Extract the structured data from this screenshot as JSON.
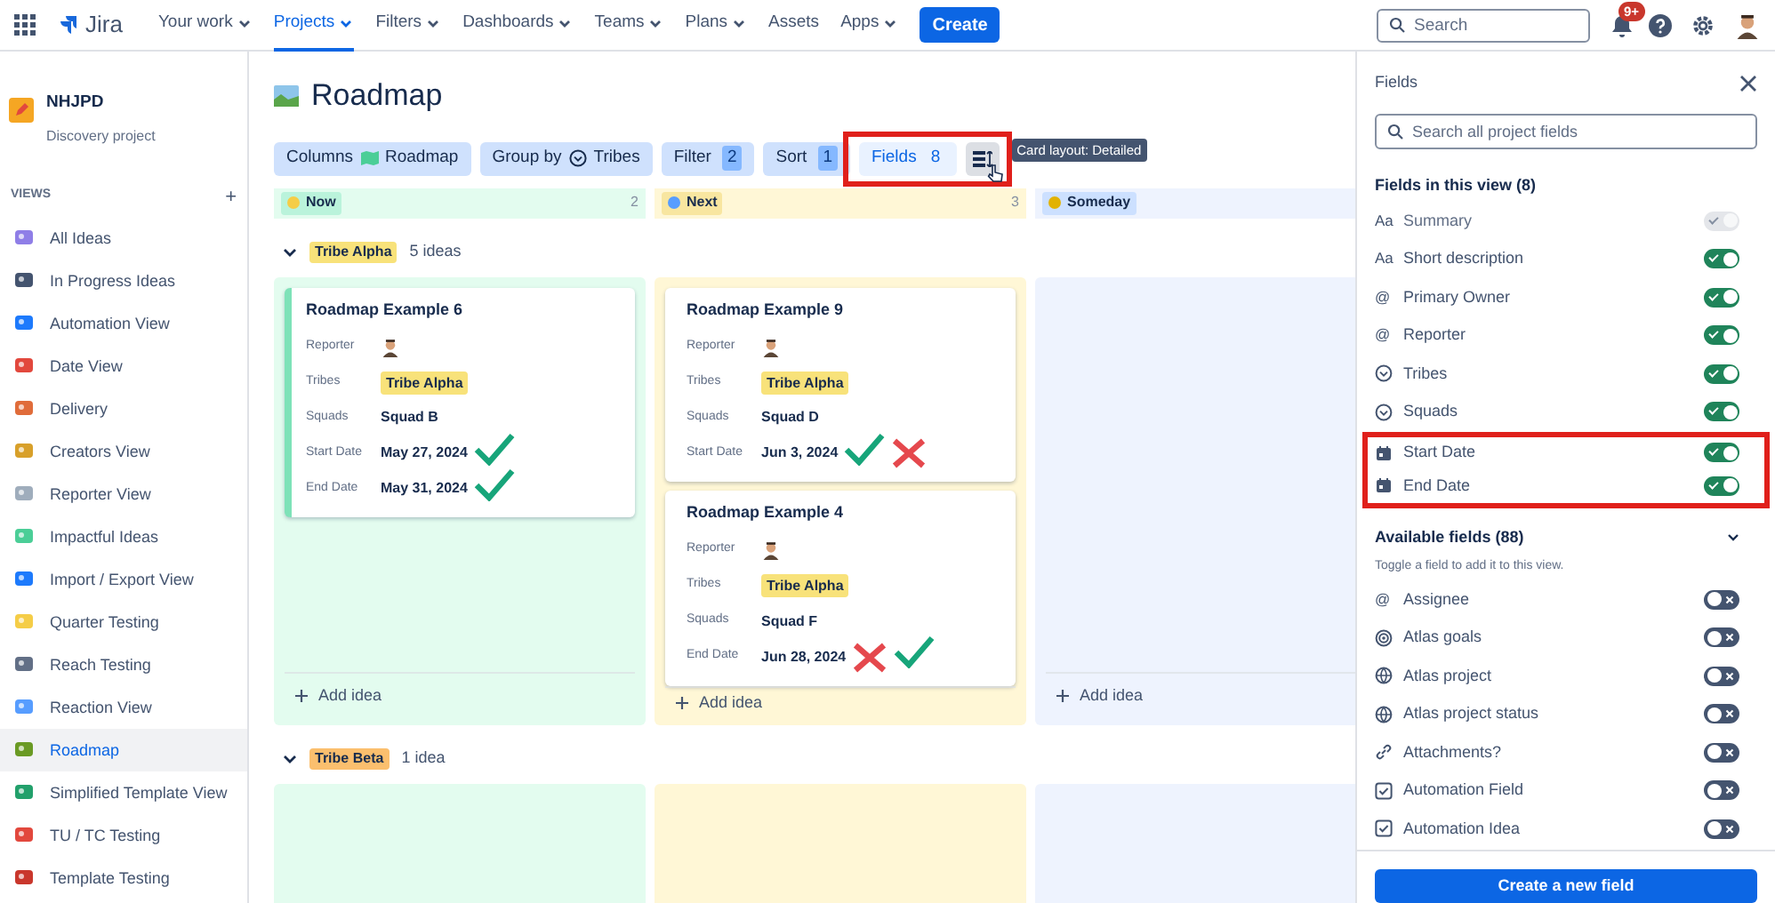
{
  "top_nav": {
    "product": "Jira",
    "items": [
      {
        "label": "Your work",
        "selected": false,
        "has_menu": true
      },
      {
        "label": "Projects",
        "selected": true,
        "has_menu": true
      },
      {
        "label": "Filters",
        "selected": false,
        "has_menu": true
      },
      {
        "label": "Dashboards",
        "selected": false,
        "has_menu": true
      },
      {
        "label": "Teams",
        "selected": false,
        "has_menu": true
      },
      {
        "label": "Plans",
        "selected": false,
        "has_menu": true
      },
      {
        "label": "Assets",
        "selected": false,
        "has_menu": false
      },
      {
        "label": "Apps",
        "selected": false,
        "has_menu": true
      }
    ],
    "create": "Create",
    "search": {
      "placeholder": "Search"
    },
    "notifications": "9+"
  },
  "sidebar": {
    "project": {
      "name": "NHJPD",
      "type": "Discovery project"
    },
    "section": "VIEWS",
    "add": "+",
    "items": [
      {
        "label": "All Ideas",
        "selected": false
      },
      {
        "label": "In Progress Ideas",
        "selected": false
      },
      {
        "label": "Automation View",
        "selected": false
      },
      {
        "label": "Date View",
        "selected": false
      },
      {
        "label": "Delivery",
        "selected": false
      },
      {
        "label": "Creators View",
        "selected": false
      },
      {
        "label": "Reporter View",
        "selected": false
      },
      {
        "label": "Impactful Ideas",
        "selected": false
      },
      {
        "label": "Import / Export View",
        "selected": false
      },
      {
        "label": "Quarter Testing",
        "selected": false
      },
      {
        "label": "Reach Testing",
        "selected": false
      },
      {
        "label": "Reaction View",
        "selected": false
      },
      {
        "label": "Roadmap",
        "selected": true
      },
      {
        "label": "Simplified Template View",
        "selected": false
      },
      {
        "label": "TU / TC Testing",
        "selected": false
      },
      {
        "label": "Template Testing",
        "selected": false
      }
    ]
  },
  "view": {
    "title": "Roadmap",
    "toolbar": [
      {
        "kind": "columns",
        "label": "Columns",
        "value": "Roadmap",
        "highlighted": false
      },
      {
        "kind": "group",
        "label": "Group by",
        "value": "Tribes",
        "highlighted": false
      },
      {
        "kind": "count",
        "label": "Filter",
        "value": "2",
        "highlighted": false
      },
      {
        "kind": "count",
        "label": "Sort",
        "value": "1",
        "highlighted": false
      },
      {
        "kind": "fields",
        "label": "Fields",
        "value": "8",
        "highlighted": true
      },
      {
        "kind": "layout",
        "highlighted": true,
        "tooltip": "Card layout: Detailed"
      }
    ],
    "columns": [
      {
        "label": "Now",
        "count": "2",
        "color": "#e3fcef"
      },
      {
        "label": "Next",
        "count": "3",
        "color": "#fff7d6"
      },
      {
        "label": "Someday",
        "color": "#eef3fe"
      }
    ],
    "lanes": [
      {
        "tag": "Tribe Alpha",
        "color": "#f8e27a",
        "count": "5 ideas",
        "expanded": true,
        "cells": [
          {
            "cards": [
              {
                "title": "Roadmap Example 6",
                "selected": true,
                "fields": [
                  {
                    "label": "Reporter",
                    "kind": "avatar"
                  },
                  {
                    "label": "Tribes",
                    "kind": "tag",
                    "value": "Tribe Alpha"
                  },
                  {
                    "label": "Squads",
                    "kind": "text",
                    "value": "Squad B"
                  },
                  {
                    "label": "Start Date",
                    "kind": "text",
                    "value": "May 27, 2024",
                    "marks": [
                      {
                        "kind": "check"
                      }
                    ]
                  },
                  {
                    "label": "End Date",
                    "kind": "text",
                    "value": "May 31, 2024",
                    "marks": [
                      {
                        "kind": "check"
                      }
                    ]
                  }
                ]
              }
            ],
            "add": "Add idea"
          },
          {
            "cards": [
              {
                "title": "Roadmap Example 9",
                "selected": false,
                "fields": [
                  {
                    "label": "Reporter",
                    "kind": "avatar"
                  },
                  {
                    "label": "Tribes",
                    "kind": "tag",
                    "value": "Tribe Alpha"
                  },
                  {
                    "label": "Squads",
                    "kind": "text",
                    "value": "Squad D"
                  },
                  {
                    "label": "Start Date",
                    "kind": "text",
                    "value": "Jun 3, 2024",
                    "marks": [
                      {
                        "kind": "check"
                      },
                      {
                        "kind": "cross"
                      }
                    ]
                  }
                ]
              },
              {
                "title": "Roadmap Example 4",
                "selected": false,
                "fields": [
                  {
                    "label": "Reporter",
                    "kind": "avatar"
                  },
                  {
                    "label": "Tribes",
                    "kind": "tag",
                    "value": "Tribe Alpha"
                  },
                  {
                    "label": "Squads",
                    "kind": "text",
                    "value": "Squad F"
                  },
                  {
                    "label": "End Date",
                    "kind": "text",
                    "value": "Jun 28, 2024",
                    "marks": [
                      {
                        "kind": "cross"
                      },
                      {
                        "kind": "check"
                      }
                    ]
                  }
                ]
              }
            ],
            "add": "Add idea"
          },
          {
            "add": "Add idea"
          }
        ]
      },
      {
        "tag": "Tribe Beta",
        "color": "#fbbf6e",
        "count": "1 idea",
        "expanded": true,
        "cells": [
          {},
          {},
          {}
        ]
      }
    ]
  },
  "fields_panel": {
    "title": "Fields",
    "search": {
      "placeholder": "Search all project fields"
    },
    "in_view": {
      "title": "Fields in this view (8)",
      "items": [
        {
          "label": "Summary",
          "kind": "text",
          "glyph": "Aa",
          "on": true,
          "disabled": true,
          "highlighted": false
        },
        {
          "label": "Short description",
          "kind": "text",
          "glyph": "Aa",
          "on": true,
          "disabled": false,
          "highlighted": false
        },
        {
          "label": "Primary Owner",
          "kind": "text",
          "glyph": "@",
          "on": true,
          "disabled": false,
          "highlighted": false
        },
        {
          "label": "Reporter",
          "kind": "text",
          "glyph": "@",
          "on": true,
          "disabled": false,
          "highlighted": false
        },
        {
          "label": "Tribes",
          "kind": "select",
          "on": true,
          "disabled": false,
          "highlighted": false
        },
        {
          "label": "Squads",
          "kind": "select",
          "on": true,
          "disabled": false,
          "highlighted": false
        },
        {
          "label": "Start Date",
          "kind": "date",
          "on": true,
          "disabled": false,
          "highlighted": true
        },
        {
          "label": "End Date",
          "kind": "date",
          "on": true,
          "disabled": false,
          "highlighted": true
        }
      ]
    },
    "available": {
      "title": "Available fields (88)",
      "expanded": true,
      "hint": "Toggle a field to add it to this view.",
      "items": [
        {
          "label": "Assignee",
          "kind": "text",
          "glyph": "@",
          "on": false,
          "disabled": false,
          "highlighted": false
        },
        {
          "label": "Atlas goals",
          "kind": "goal",
          "on": false,
          "disabled": false,
          "highlighted": false
        },
        {
          "label": "Atlas project",
          "kind": "globe",
          "on": false,
          "disabled": false,
          "highlighted": false
        },
        {
          "label": "Atlas project status",
          "kind": "globe",
          "on": false,
          "disabled": false,
          "highlighted": false
        },
        {
          "label": "Attachments?",
          "kind": "link",
          "on": false,
          "disabled": false,
          "highlighted": false
        },
        {
          "label": "Automation Field",
          "kind": "checkbox",
          "on": false,
          "disabled": false,
          "highlighted": false
        },
        {
          "label": "Automation Idea",
          "kind": "checkbox",
          "on": false,
          "disabled": false,
          "highlighted": false
        }
      ]
    },
    "create": "Create a new field"
  }
}
